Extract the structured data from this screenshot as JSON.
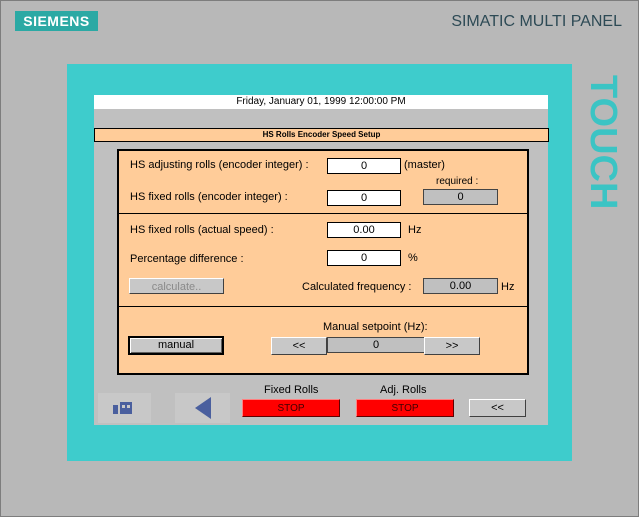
{
  "device": {
    "brand": "SIEMENS",
    "model": "SIMATIC MULTI PANEL",
    "touch_label": "TOUCH"
  },
  "header": {
    "datetime": "Friday, January 01, 1999 12:00:00 PM",
    "title": "HS Rolls Encoder Speed Setup"
  },
  "encoder": {
    "adjusting_label": "HS adjusting rolls (encoder integer) :",
    "adjusting_value": "0",
    "adjusting_note": "(master)",
    "fixed_label": "HS fixed rolls (encoder integer) :",
    "fixed_value": "0",
    "required_label": "required :",
    "required_value": "0"
  },
  "speed": {
    "actual_label": "HS fixed rolls (actual speed) :",
    "actual_value": "0.00",
    "actual_unit": "Hz",
    "percent_label": "Percentage difference :",
    "percent_value": "0",
    "percent_unit": "%",
    "calculate_label": "calculate..",
    "calc_freq_label": "Calculated frequency :",
    "calc_freq_value": "0.00",
    "calc_freq_unit": "Hz"
  },
  "manual": {
    "button_label": "manual",
    "setpoint_label": "Manual setpoint (Hz):",
    "decrease_label": "<<",
    "setpoint_value": "0",
    "increase_label": ">>"
  },
  "footer": {
    "fixed_rolls_label": "Fixed Rolls",
    "fixed_rolls_status": "STOP",
    "adj_rolls_label": "Adj. Rolls",
    "adj_rolls_status": "STOP",
    "back_label": "<<",
    "status_color": "#ff0000"
  }
}
